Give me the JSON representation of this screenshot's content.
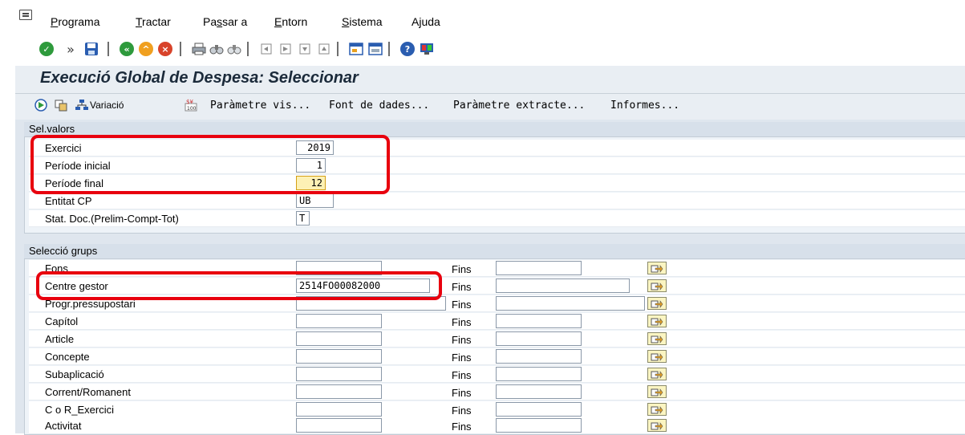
{
  "menu": {
    "items": [
      {
        "label": "Programa",
        "key": "P",
        "rest": "rograma"
      },
      {
        "label": "Tractar",
        "key": "T",
        "rest": "ractar"
      },
      {
        "label": "Passar a",
        "pre": "Pa",
        "key": "s",
        "rest": "sar a"
      },
      {
        "label": "Entorn",
        "key": "E",
        "rest": "ntorn"
      },
      {
        "label": "Sistema",
        "key": "S",
        "rest": "istema"
      },
      {
        "label": "Ajuda",
        "pre": "A",
        "key": "j",
        "rest": "uda"
      }
    ]
  },
  "toolbar": {
    "icons": [
      "enter-icon",
      "command-field-icon",
      "save-icon",
      "back-icon",
      "exit-icon",
      "cancel-icon",
      "print-icon",
      "find-icon",
      "find-next-icon",
      "first-page-icon",
      "previous-page-icon",
      "next-page-icon",
      "last-page-icon",
      "create-session-icon",
      "shortcut-icon",
      "help-icon",
      "customize-layout-icon"
    ]
  },
  "title": "Execució Global de Despesa: Seleccionar",
  "app_toolbar": {
    "variacio": "Variació",
    "parametre_vis": "Paràmetre vis...",
    "font_dades": "Font de dades...",
    "parametre_extracte": "Paràmetre extracte...",
    "informes": "Informes..."
  },
  "sel_valors": {
    "title": "Sel.valors",
    "rows": [
      {
        "label": "Exercici",
        "value": "2019"
      },
      {
        "label": "Període inicial",
        "value": "1"
      },
      {
        "label": "Període final",
        "value": "12"
      },
      {
        "label": "Entitat CP",
        "value": "UB"
      },
      {
        "label": "Stat. Doc.(Prelim-Compt-Tot)",
        "value": "T"
      }
    ]
  },
  "seleccio_grups": {
    "title": "Selecció grups",
    "fins_label": "Fins",
    "rows": [
      {
        "label": "Fons",
        "from": "",
        "to": ""
      },
      {
        "label": "Centre gestor",
        "from": "2514FO00082000",
        "to": ""
      },
      {
        "label": "Progr.pressupostari",
        "from": "",
        "to": ""
      },
      {
        "label": "Capítol",
        "from": "",
        "to": ""
      },
      {
        "label": "Article",
        "from": "",
        "to": ""
      },
      {
        "label": "Concepte",
        "from": "",
        "to": ""
      },
      {
        "label": "Subaplicació",
        "from": "",
        "to": ""
      },
      {
        "label": "Corrent/Romanent",
        "from": "",
        "to": ""
      },
      {
        "label": "C o R_Exercici",
        "from": "",
        "to": ""
      },
      {
        "label": "Activitat",
        "from": "",
        "to": ""
      }
    ]
  },
  "colors": {
    "highlight": "#e8000e",
    "panel": "#dfe6ee",
    "title_bar": "#e9eef3"
  }
}
